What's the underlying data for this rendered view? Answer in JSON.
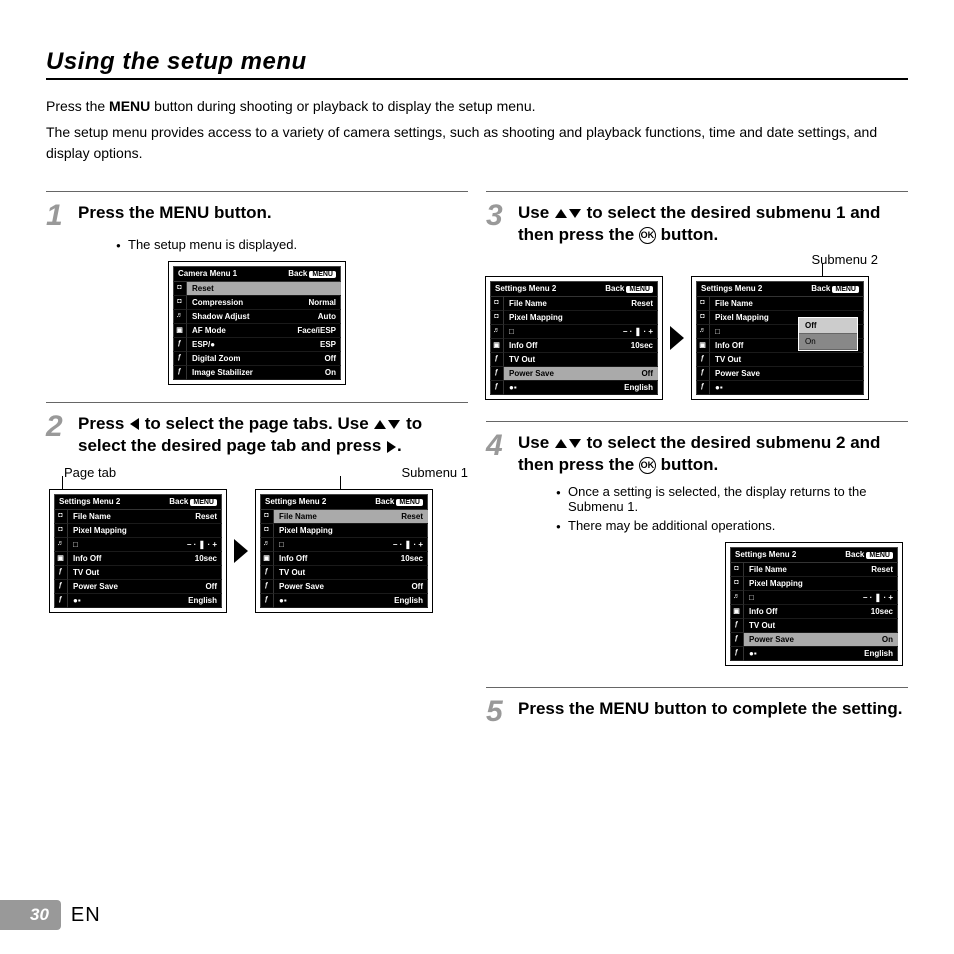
{
  "title": "Using the setup menu",
  "intro1a": "Press the ",
  "intro1b": "MENU",
  "intro1c": " button during shooting or playback to display the setup menu.",
  "intro2": "The setup menu provides access to a variety of camera settings, such as shooting and playback functions, time and date settings, and display options.",
  "steps": {
    "s1": {
      "num": "1",
      "txt": "Press the MENU button.",
      "bul": "The setup menu is displayed."
    },
    "s2": {
      "num": "2",
      "txtA": "Press ",
      "txtB": " to select the page tabs. Use ",
      "txtC": " to select the desired page tab and press ",
      "txtD": "."
    },
    "s3": {
      "num": "3",
      "txtA": "Use ",
      "txtB": " to select the desired submenu 1 and then press the ",
      "txtC": " button."
    },
    "s4": {
      "num": "4",
      "txtA": "Use ",
      "txtB": " to select the desired submenu 2 and then press the ",
      "txtC": " button.",
      "bul1": "Once a setting is selected, the display returns to the Submenu 1.",
      "bul2": "There may be additional operations."
    },
    "s5": {
      "num": "5",
      "txt": "Press the MENU button to complete the setting."
    }
  },
  "captions": {
    "pagetab": "Page tab",
    "sub1": "Submenu 1",
    "sub2": "Submenu 2"
  },
  "screens": {
    "camera": {
      "title": "Camera Menu 1",
      "back": "Back",
      "badge": "MENU",
      "rows": [
        {
          "l": "Reset",
          "v": "",
          "sel": true
        },
        {
          "l": "Compression",
          "v": "Normal"
        },
        {
          "l": "Shadow Adjust",
          "v": "Auto"
        },
        {
          "l": "AF Mode",
          "v": "Face/iESP"
        },
        {
          "l": "ESP/●",
          "v": "ESP"
        },
        {
          "l": "Digital Zoom",
          "v": "Off"
        },
        {
          "l": "Image Stabilizer",
          "v": "On"
        }
      ]
    },
    "settings_a": {
      "title": "Settings Menu 2",
      "back": "Back",
      "badge": "MENU",
      "rows": [
        {
          "l": "File Name",
          "v": "Reset"
        },
        {
          "l": "Pixel Mapping",
          "v": ""
        },
        {
          "l": "□",
          "v": "– · ❚ · +"
        },
        {
          "l": "Info Off",
          "v": "10sec"
        },
        {
          "l": "TV Out",
          "v": ""
        },
        {
          "l": "Power Save",
          "v": "Off"
        },
        {
          "l": "●▪",
          "v": "English"
        }
      ]
    },
    "settings_file_sel": {
      "title": "Settings Menu 2",
      "back": "Back",
      "badge": "MENU",
      "rows": [
        {
          "l": "File Name",
          "v": "Reset",
          "sel": true
        },
        {
          "l": "Pixel Mapping",
          "v": ""
        },
        {
          "l": "□",
          "v": "– · ❚ · +"
        },
        {
          "l": "Info Off",
          "v": "10sec"
        },
        {
          "l": "TV Out",
          "v": ""
        },
        {
          "l": "Power Save",
          "v": "Off"
        },
        {
          "l": "●▪",
          "v": "English"
        }
      ]
    },
    "settings_power_sel": {
      "title": "Settings Menu 2",
      "back": "Back",
      "badge": "MENU",
      "rows": [
        {
          "l": "File Name",
          "v": "Reset"
        },
        {
          "l": "Pixel Mapping",
          "v": ""
        },
        {
          "l": "□",
          "v": "– · ❚ · +"
        },
        {
          "l": "Info Off",
          "v": "10sec"
        },
        {
          "l": "TV Out",
          "v": ""
        },
        {
          "l": "Power Save",
          "v": "Off",
          "sel": true
        },
        {
          "l": "●▪",
          "v": "English"
        }
      ]
    },
    "settings_power_on": {
      "title": "Settings Menu 2",
      "back": "Back",
      "badge": "MENU",
      "rows": [
        {
          "l": "File Name",
          "v": "Reset"
        },
        {
          "l": "Pixel Mapping",
          "v": ""
        },
        {
          "l": "□",
          "v": "– · ❚ · +"
        },
        {
          "l": "Info Off",
          "v": "10sec"
        },
        {
          "l": "TV Out",
          "v": ""
        },
        {
          "l": "Power Save",
          "v": "On",
          "sel": true
        },
        {
          "l": "●▪",
          "v": "English"
        }
      ]
    },
    "popup": {
      "title": "Settings Menu 2",
      "back": "Back",
      "badge": "MENU",
      "rows": [
        {
          "l": "File Name",
          "v": ""
        },
        {
          "l": "Pixel Mapping",
          "v": ""
        },
        {
          "l": "□",
          "v": ""
        },
        {
          "l": "Info Off",
          "v": ""
        },
        {
          "l": "TV Out",
          "v": ""
        },
        {
          "l": "Power Save",
          "v": ""
        },
        {
          "l": "●▪",
          "v": ""
        }
      ],
      "opts": [
        {
          "t": "Off",
          "sel": true
        },
        {
          "t": "On"
        }
      ]
    }
  },
  "ok_label": "OK",
  "footer": {
    "page": "30",
    "lang": "EN"
  }
}
